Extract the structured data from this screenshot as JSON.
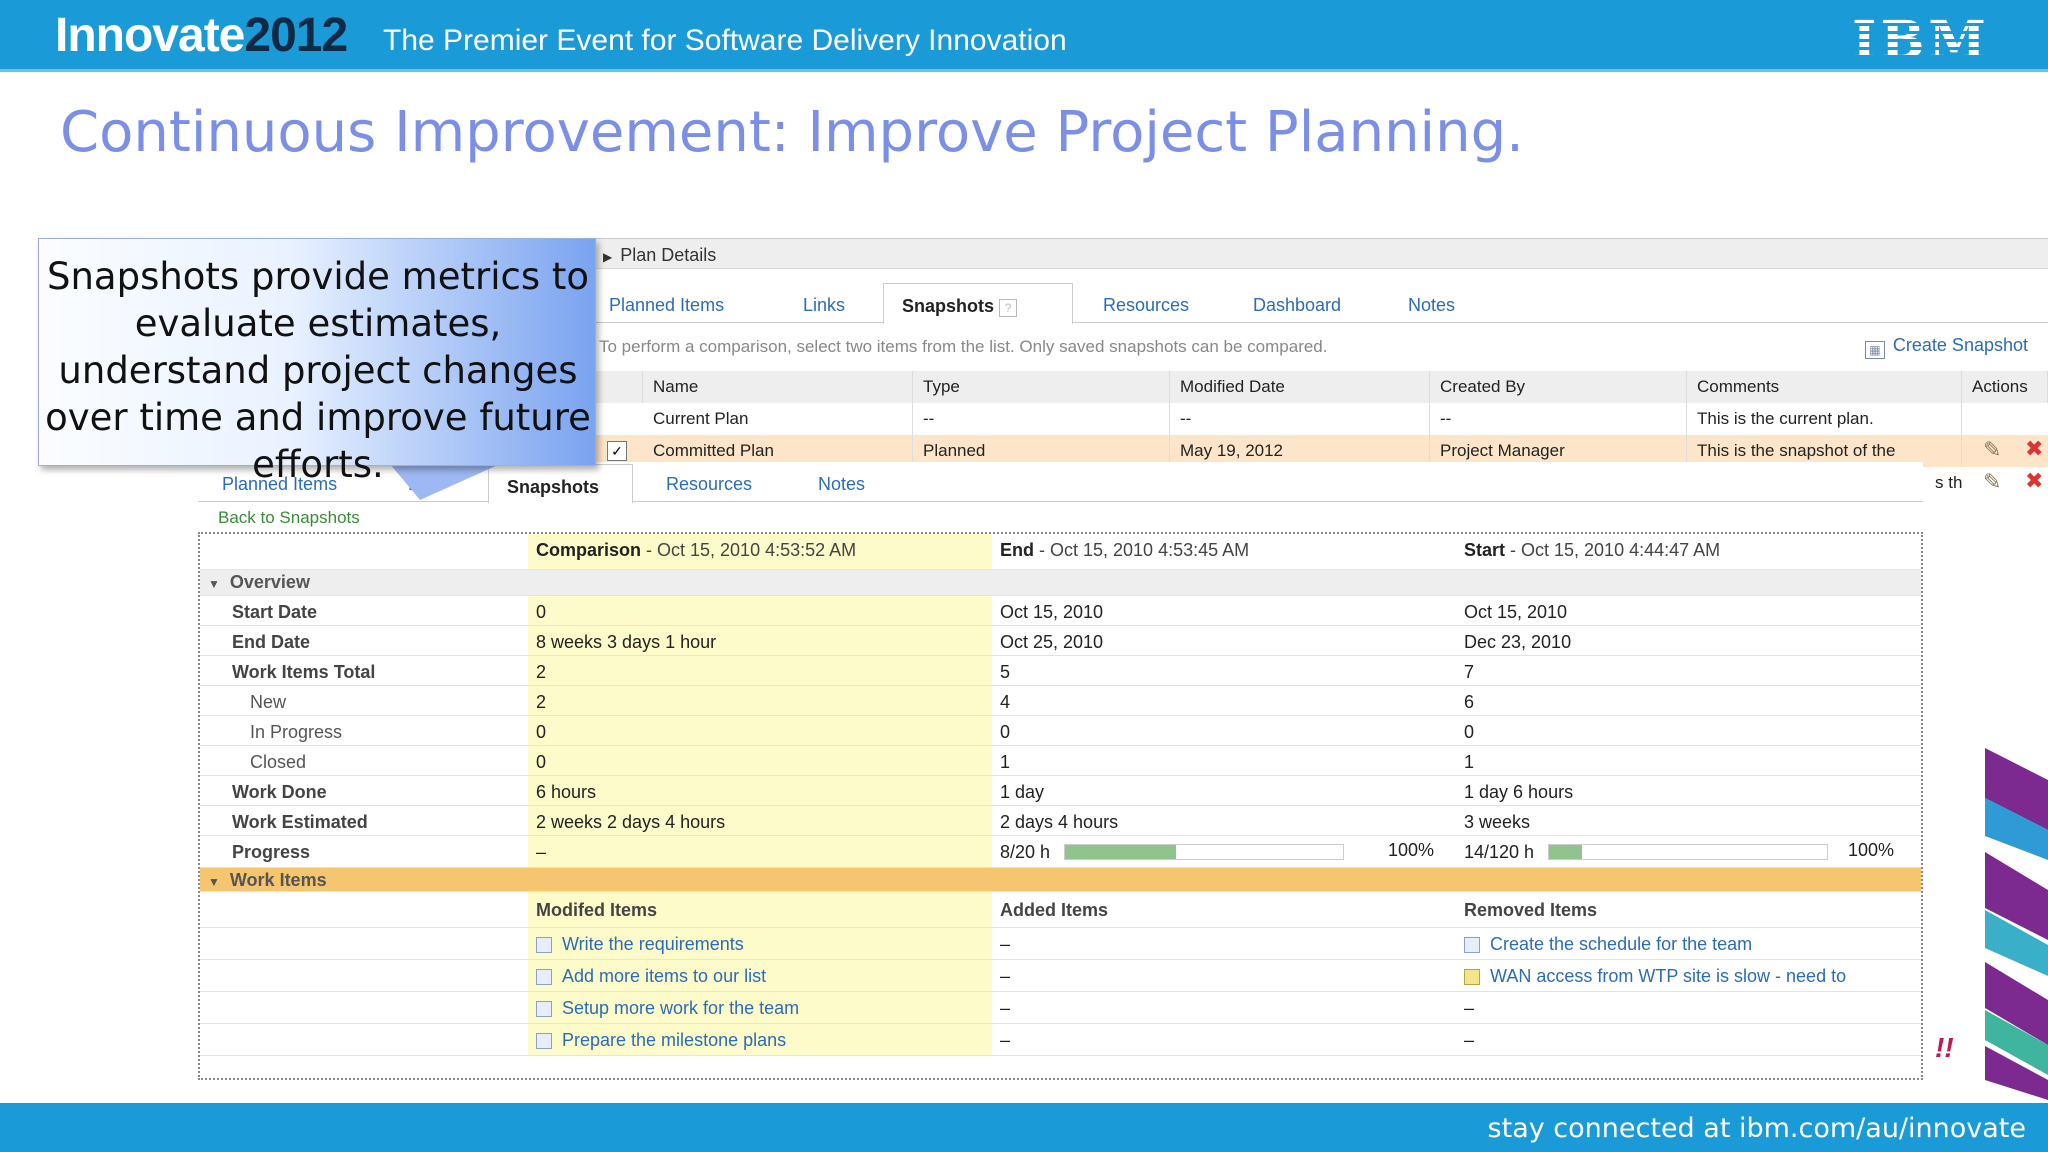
{
  "header": {
    "brand_prefix": "Innovate",
    "brand_year": "2012",
    "tagline": "The Premier Event for Software Delivery Innovation",
    "logo": "IBM"
  },
  "slide_title": "Continuous Improvement:  Improve Project Planning.",
  "callout": {
    "text": "Snapshots provide metrics to evaluate estimates, understand project changes over time and improve future efforts."
  },
  "plan_details": {
    "heading": "Plan Details",
    "tabs": [
      "Planned Items",
      "Links",
      "Snapshots",
      "Resources",
      "Dashboard",
      "Notes"
    ],
    "hint": "To perform a comparison, select two items from the list. Only saved snapshots can be compared.",
    "create_snapshot": "Create Snapshot",
    "columns": [
      "Name",
      "Type",
      "Modified Date",
      "Created By",
      "Comments",
      "Actions"
    ],
    "rows": [
      {
        "name": "Current Plan",
        "type": "--",
        "modified": "--",
        "created_by": "--",
        "comments": "This is the current plan."
      },
      {
        "name": "Committed Plan",
        "type": "Planned",
        "modified": "May 19, 2012",
        "created_by": "Project Manager",
        "comments": "This is the snapshot of the"
      }
    ],
    "overflow_text": "s th"
  },
  "comparison": {
    "tabs": [
      "Planned Items",
      "Lin",
      "Snapshots",
      "Resources",
      "Notes"
    ],
    "back_link": "Back to Snapshots",
    "col_headers": [
      {
        "title": "Comparison",
        "date": " - Oct 15, 2010 4:53:52 AM"
      },
      {
        "title": "End",
        "date": " - Oct 15, 2010 4:53:45 AM"
      },
      {
        "title": "Start",
        "date": " - Oct 15, 2010 4:44:47 AM"
      }
    ],
    "overview_label": "Overview",
    "overview": [
      {
        "label": "Start Date",
        "comparison": "0",
        "end": "Oct 15, 2010",
        "start": "Oct 15, 2010",
        "sub": false
      },
      {
        "label": "End Date",
        "comparison": "8 weeks 3 days 1 hour",
        "end": "Oct 25, 2010",
        "start": "Dec 23, 2010",
        "sub": false
      },
      {
        "label": "Work Items Total",
        "comparison": "2",
        "end": "5",
        "start": "7",
        "sub": false
      },
      {
        "label": "New",
        "comparison": "2",
        "end": "4",
        "start": "6",
        "sub": true
      },
      {
        "label": "In Progress",
        "comparison": "0",
        "end": "0",
        "start": "0",
        "sub": true
      },
      {
        "label": "Closed",
        "comparison": "0",
        "end": "1",
        "start": "1",
        "sub": true
      },
      {
        "label": "Work Done",
        "comparison": "6 hours",
        "end": "1 day",
        "start": "1 day 6 hours",
        "sub": false
      },
      {
        "label": "Work Estimated",
        "comparison": "2 weeks 2 days 4 hours",
        "end": "2 days 4 hours",
        "start": "3 weeks",
        "sub": false
      }
    ],
    "progress": {
      "label": "Progress",
      "comparison": "–",
      "end": {
        "text": "8/20 h",
        "fill": 0.4,
        "pct": "100%"
      },
      "start": {
        "text": "14/120 h",
        "fill": 0.12,
        "pct": "100%"
      }
    },
    "work_items_label": "Work Items",
    "work_items_headers": [
      "Modifed Items",
      "Added Items",
      "Removed Items"
    ],
    "work_items": [
      {
        "modified": "Write the requirements",
        "added": "–",
        "removed": "Create the schedule for the team"
      },
      {
        "modified": "Add more items to our list",
        "added": "–",
        "removed": "WAN access from WTP site is slow - need to"
      },
      {
        "modified": "Setup more work for the team",
        "added": "–",
        "removed": "–"
      },
      {
        "modified": "Prepare the milestone plans",
        "added": "–",
        "removed": "–"
      }
    ]
  },
  "footer": "stay connected at ibm.com/au/innovate",
  "colors": {
    "banner": "#1a9ad6",
    "title": "#7b8fe6",
    "highlight": "#fdfbc9",
    "section": "#f6c56f",
    "selected_row": "#fde5c9",
    "progress": "#90c48e",
    "link": "#2b6db3"
  },
  "icons": [
    "edit-pencil-icon",
    "delete-x-icon",
    "work-item-icon",
    "create-snapshot-icon",
    "help-icon",
    "collapse-triangle-icon"
  ]
}
